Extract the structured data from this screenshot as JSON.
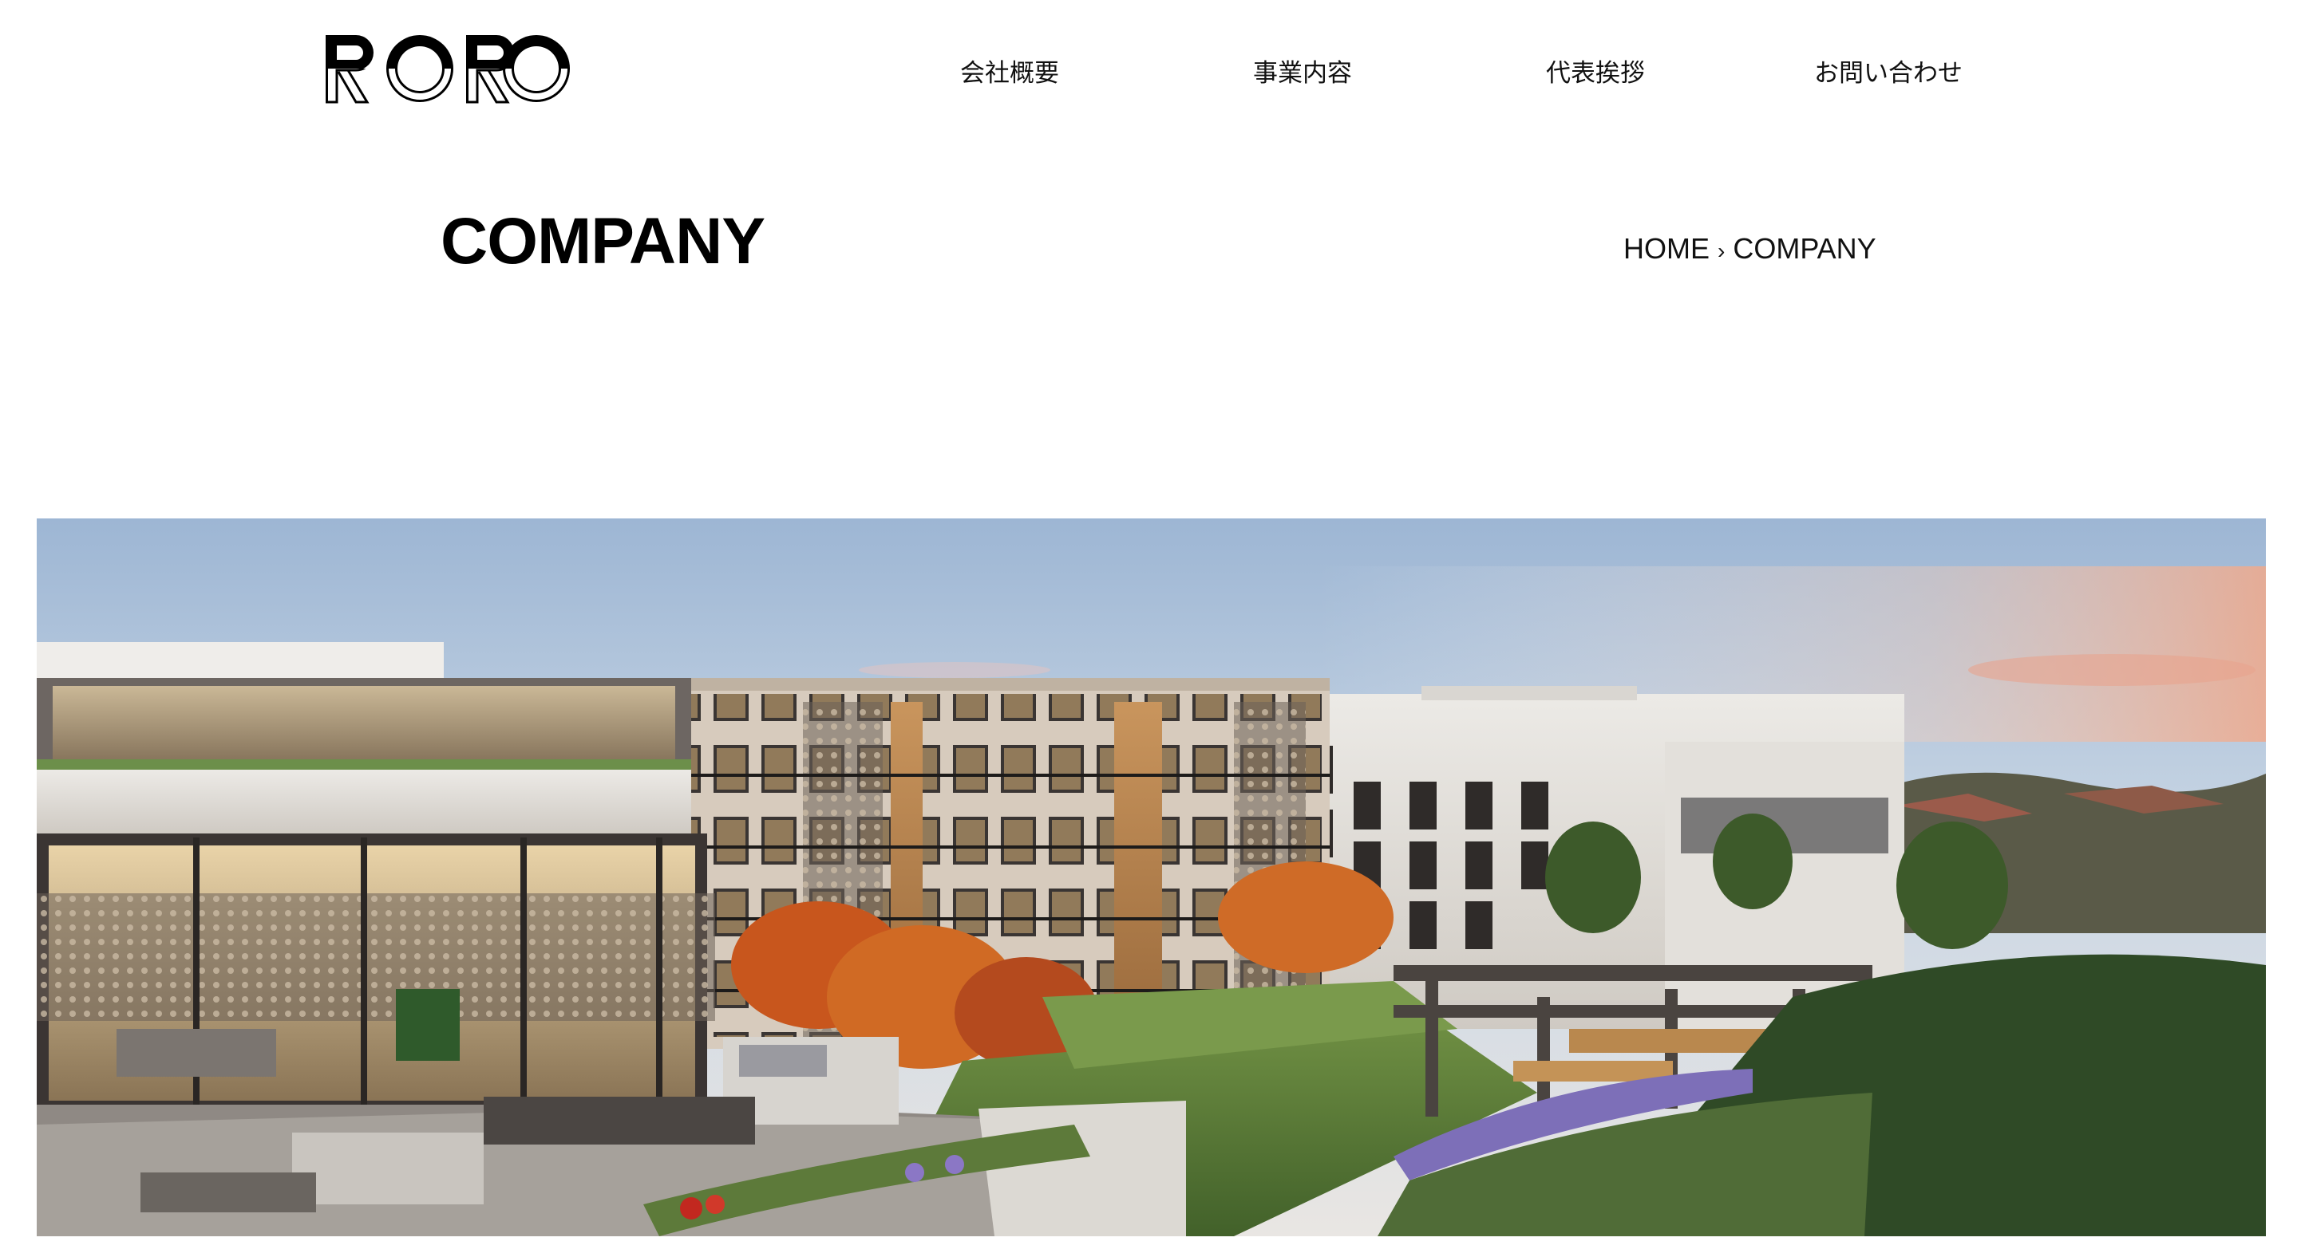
{
  "header": {
    "logo_text": "RORO",
    "nav": [
      {
        "label": "会社概要"
      },
      {
        "label": "事業内容"
      },
      {
        "label": "代表挨拶"
      },
      {
        "label": "お問い合わせ"
      }
    ]
  },
  "page": {
    "title": "COMPANY",
    "breadcrumb": {
      "home": "HOME",
      "separator": "›",
      "current": "COMPANY"
    }
  },
  "hero": {
    "subject": "modern apartment complex courtyard at dusk"
  }
}
